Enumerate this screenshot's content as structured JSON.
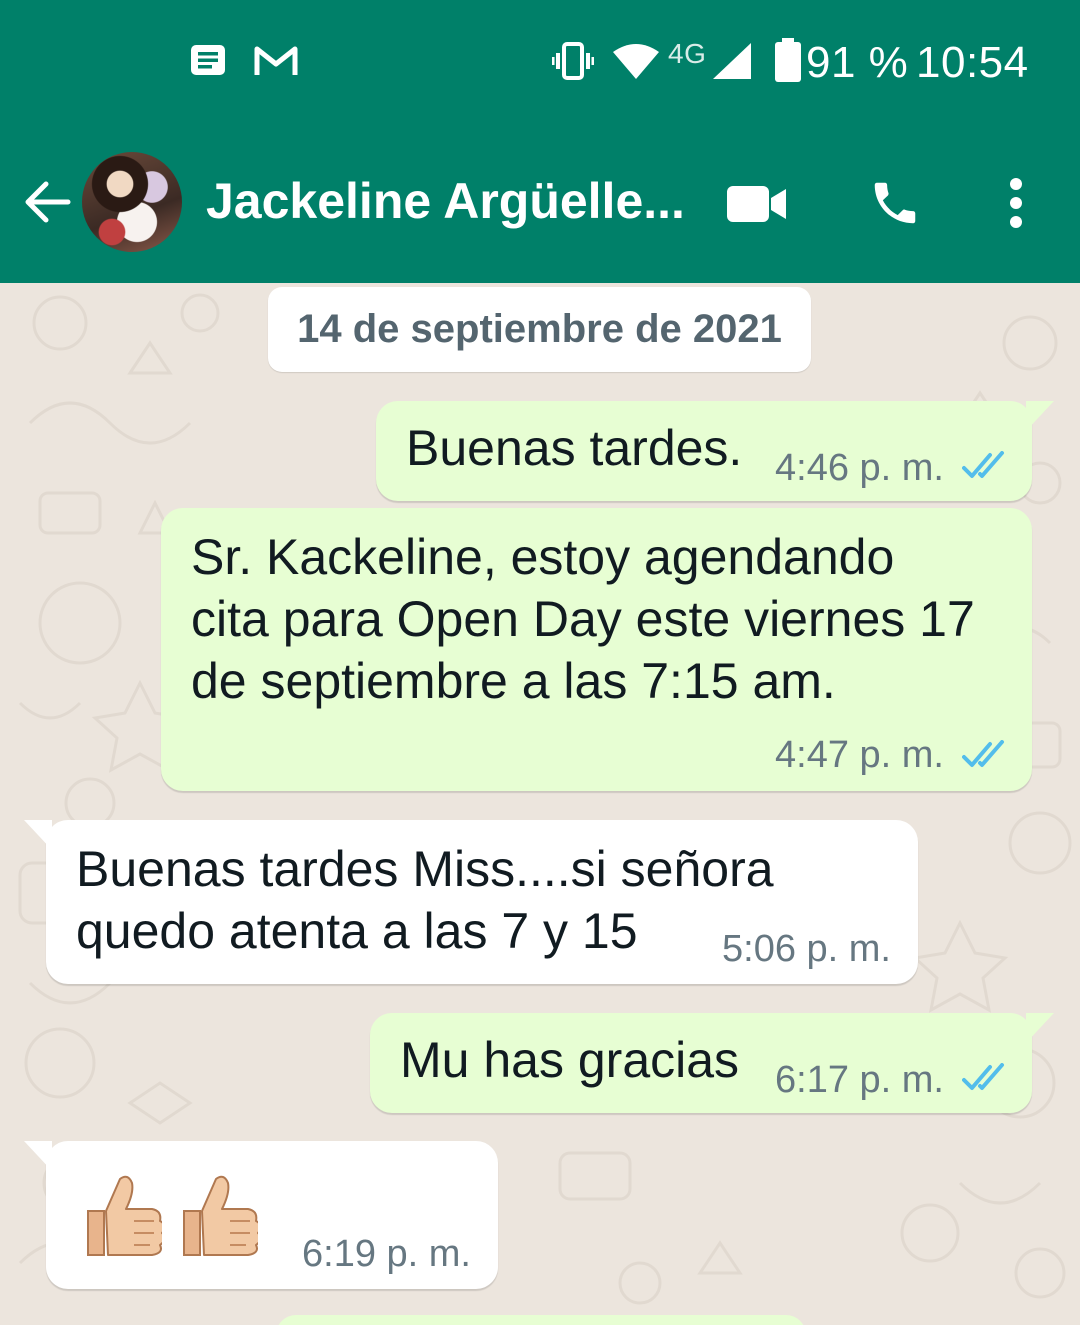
{
  "status_bar": {
    "icons": [
      "message-icon",
      "gmail-icon",
      "vibrate-icon",
      "wifi-icon",
      "signal-icon",
      "battery-icon"
    ],
    "network_label": "4G",
    "battery": "91 %",
    "time": "10:54"
  },
  "header": {
    "contact_name": "Jackeline Argüelle...",
    "icons": [
      "back-arrow-icon",
      "video-call-icon",
      "phone-icon",
      "more-options-icon"
    ]
  },
  "chat": {
    "date_chip": "14 de septiembre de 2021",
    "messages": [
      {
        "direction": "outgoing",
        "text": "Buenas tardes.",
        "time": "4:46 p. m.",
        "status": "read"
      },
      {
        "direction": "outgoing",
        "text": "Sr. Kackeline, estoy agendando\ncita para Open Day este viernes 17\nde septiembre a las 7:15 am.",
        "time": "4:47 p. m.",
        "status": "read"
      },
      {
        "direction": "incoming",
        "text": "Buenas tardes Miss....si señora\nquedo atenta a las 7 y 15",
        "time": "5:06 p. m."
      },
      {
        "direction": "outgoing",
        "text": "Mu has gracias",
        "time": "6:17 p. m.",
        "status": "read"
      },
      {
        "direction": "incoming",
        "text": "👍👍",
        "time": "6:19 p. m."
      }
    ]
  },
  "colors": {
    "header": "#008069",
    "chat_background": "#ece5dd",
    "outgoing_bubble": "#e7fed3",
    "incoming_bubble": "#ffffff",
    "read_ticks": "#53bdeb",
    "meta_text": "#667781"
  }
}
